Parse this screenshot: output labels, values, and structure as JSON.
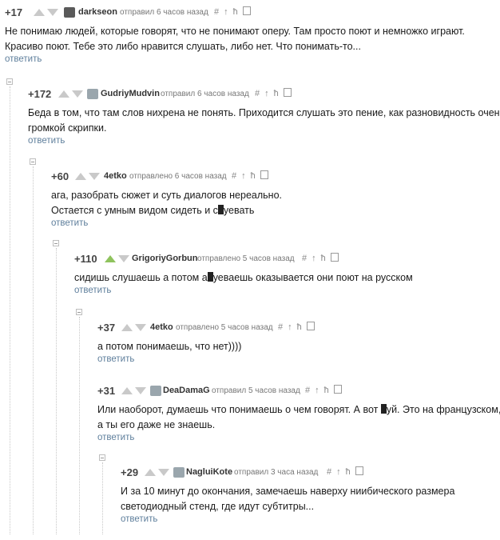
{
  "icons": {
    "share": "#",
    "uparrow": "↑",
    "branch": "ħ"
  },
  "comments": [
    {
      "rating": "+17",
      "author": "darkseon",
      "meta": "отправил 6 часов назад",
      "lines": [
        "Не понимаю людей, которые говорят, что не понимают оперу. Там просто поют и немножко играют.",
        "Красиво поют. Тебе это либо нравится слушать, либо нет. Что понимать-то..."
      ],
      "reply": "ответить"
    },
    {
      "rating": "+172",
      "author": "GudriyMudvin",
      "meta": "отправил 6 часов назад",
      "lines": [
        "Беда в том, что там слов нихрена не понять. Приходится слушать это пение, как разновидность очень",
        "громкой скрипки."
      ],
      "reply": "ответить"
    },
    {
      "rating": "+60",
      "author": "4etko",
      "meta": "отправлено 6 часов назад",
      "lines": [
        "ага, разобрать сюжет и суть диалогов нереально."
      ],
      "line2a": "Остается с умным видом сидеть и с",
      "line2b": "уевать",
      "reply": "ответить"
    },
    {
      "rating": "+110",
      "author": "GrigoriyGorbun",
      "meta": "отправлено 5 часов назад",
      "line1a": "сидишь слушаешь а потом а",
      "line1b": "уеваешь оказывается они поют на русском",
      "reply": "ответить"
    },
    {
      "rating": "+37",
      "author": "4etko",
      "meta": "отправлено 5 часов назад",
      "lines": [
        "а потом понимаешь, что нет))))"
      ],
      "reply": "ответить"
    },
    {
      "rating": "+31",
      "author": "DeaDamaG",
      "meta": "отправил 5 часов назад",
      "line1a": "Или наоборот, думаешь что понимаешь о чем говорят. А вот ",
      "line1b": "уй. Это на французском,",
      "lines": [
        "а ты его даже не знаешь."
      ],
      "reply": "ответить"
    },
    {
      "rating": "+29",
      "author": "NagluiKote",
      "meta": "отправил 3 часа назад",
      "lines": [
        "И за 10 минут до окончания, замечаешь наверху ниибического размера",
        "светодиодный стенд, где идут субтитры..."
      ],
      "reply": "ответить"
    }
  ]
}
